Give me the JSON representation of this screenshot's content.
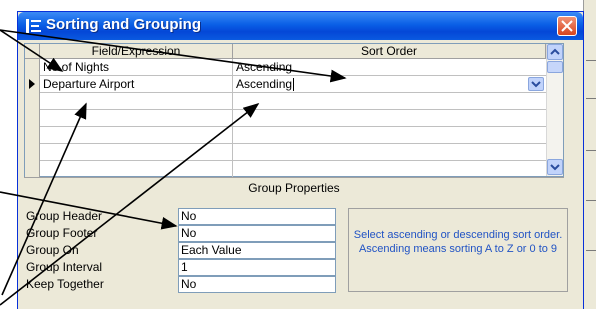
{
  "window": {
    "title": "Sorting and Grouping",
    "icon": "sorting-grouping-icon",
    "close_icon": "close-icon"
  },
  "sort_grid": {
    "columns": [
      "Field/Expression",
      "Sort Order"
    ],
    "rows": [
      {
        "field": "No of Nights",
        "sort": "Ascending"
      },
      {
        "field": "Departure Airport",
        "sort": "Ascending"
      }
    ]
  },
  "group_properties": {
    "heading": "Group Properties",
    "items": [
      {
        "label": "Group Header",
        "value": "No"
      },
      {
        "label": "Group Footer",
        "value": "No"
      },
      {
        "label": "Group On",
        "value": "Each Value"
      },
      {
        "label": "Group Interval",
        "value": "1"
      },
      {
        "label": "Keep Together",
        "value": "No"
      }
    ],
    "help_text": "Select ascending or descending sort order.  Ascending means sorting A to Z or 0 to 9"
  },
  "colors": {
    "titlebar": "#0a5fe6",
    "help_text": "#2153c4",
    "close": "#d9451f"
  }
}
